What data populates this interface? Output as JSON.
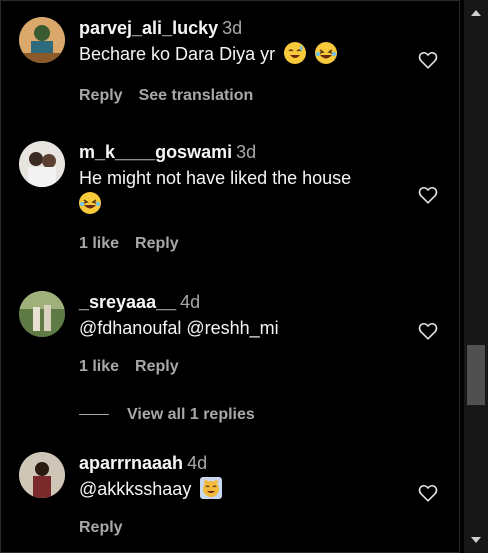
{
  "comments": [
    {
      "username": "parvej_ali_lucky",
      "time": "3d",
      "text": "Bechare ko Dara Diya yr",
      "emojis": [
        "grinning-sweat-emoji",
        "laughing-emoji"
      ],
      "actions": [
        "Reply",
        "See translation"
      ]
    },
    {
      "username": "m_k____goswami",
      "time": "3d",
      "text": "He might not have liked the house",
      "emojis": [
        "laughing-emoji"
      ],
      "actions": [
        "1 like",
        "Reply"
      ]
    },
    {
      "username": "_sreyaaa__",
      "time": "4d",
      "text": "@fdhanoufal @reshh_mi",
      "actions": [
        "1 like",
        "Reply"
      ]
    },
    {
      "username": "aparrrnaaah",
      "time": "4d",
      "text": "@akkksshaay",
      "emojis": [
        "smiling-cat-emoji"
      ],
      "actions": [
        "Reply"
      ]
    }
  ],
  "view_replies": "View all 1 replies",
  "icons": {
    "like": "heart-icon",
    "scroll_up": "scroll-up-arrow-icon",
    "scroll_down": "scroll-down-arrow-icon"
  },
  "colors": {
    "background": "#000000",
    "text": "#f5f5f5",
    "secondary_text": "#a8a8a8",
    "scrollbar_track": "#171717",
    "scrollbar_thumb": "#505050"
  }
}
